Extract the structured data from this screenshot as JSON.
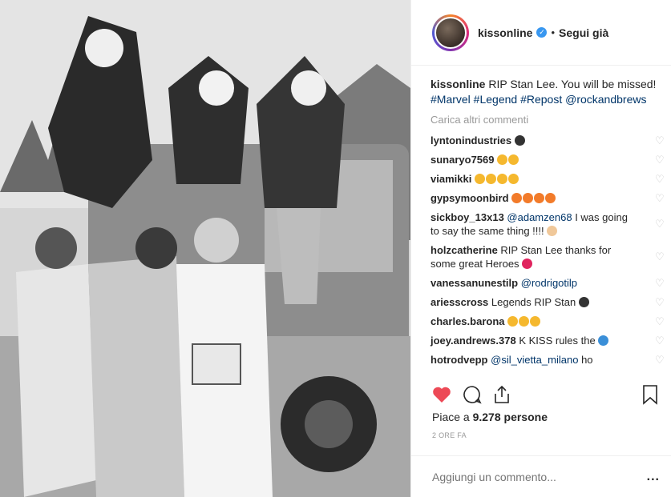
{
  "header": {
    "username": "kissonline",
    "separator": "•",
    "follow_label": "Segui già"
  },
  "caption": {
    "username": "kissonline",
    "text": "RIP Stan Lee. You will be missed!",
    "tags": "#Marvel #Legend #Repost @rockandbrews"
  },
  "load_more": "Carica altri commenti",
  "comments": [
    {
      "user": "lyntonindustries",
      "text": "",
      "emoji": [
        "#333333"
      ]
    },
    {
      "user": "sunaryo7569",
      "text": "",
      "emoji": [
        "#f5b82e",
        "#f5b82e"
      ]
    },
    {
      "user": "viamikki",
      "text": "",
      "emoji": [
        "#f5b82e",
        "#f5b82e",
        "#f5b82e",
        "#f5b82e"
      ]
    },
    {
      "user": "gypsymoonbird",
      "text": "",
      "emoji": [
        "#f27b2a",
        "#f27b2a",
        "#f27b2a",
        "#f27b2a"
      ]
    },
    {
      "user": "sickboy_13x13",
      "mention": "@adamzen68",
      "text": "I was going to say the same thing !!!!",
      "emoji": [
        "#f0c89a"
      ]
    },
    {
      "user": "holzcatherine",
      "text": "RIP Stan Lee thanks for some great Heroes",
      "emoji": [
        "#e0245e"
      ]
    },
    {
      "user": "vanessanunestilp",
      "mention": "@rodrigotilp",
      "text": "",
      "emoji": []
    },
    {
      "user": "ariesscross",
      "text": "Legends RIP Stan",
      "emoji": [
        "#333333"
      ]
    },
    {
      "user": "charles.barona",
      "text": "",
      "emoji": [
        "#f5b82e",
        "#f5b82e",
        "#f5b82e"
      ]
    },
    {
      "user": "joey.andrews.378",
      "text": "K KISS rules the",
      "emoji": [
        "#3a8fd8"
      ]
    },
    {
      "user": "hotrodvepp",
      "mention": "@sil_vietta_milano",
      "text": "ho",
      "emoji": []
    }
  ],
  "likes": {
    "prefix": "Piace a",
    "count": "9.278 persone"
  },
  "time_ago": "2 ORE FA",
  "add_comment": {
    "placeholder": "Aggiungi un commento...",
    "more": "..."
  },
  "colors": {
    "accent": "#3897f0",
    "like": "#ed4956",
    "link": "#003569"
  }
}
